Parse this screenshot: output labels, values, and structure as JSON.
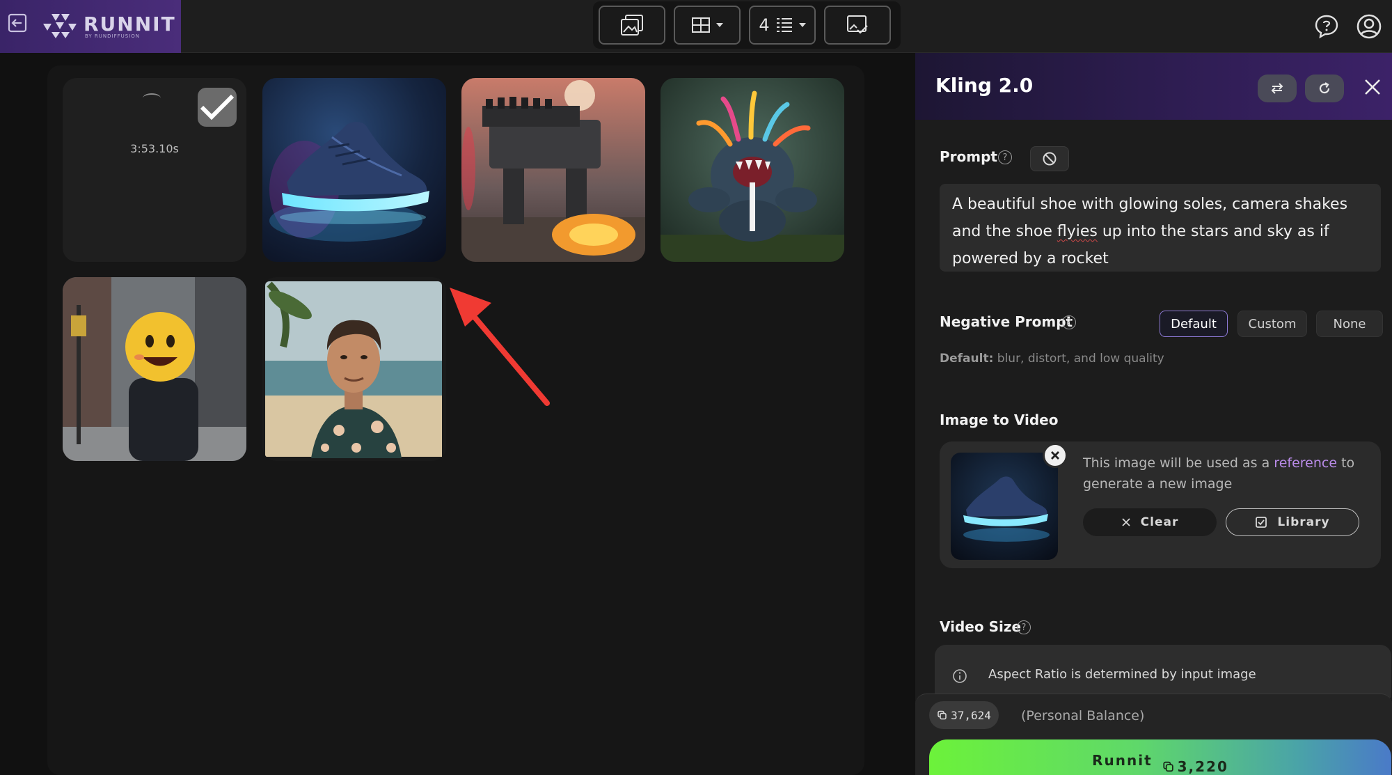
{
  "brand": {
    "name": "RUNNIT",
    "sub": "BY RUNDIFFUSION"
  },
  "toolbar": {
    "count_value": "4"
  },
  "gallery": {
    "pending_timer": "3:53.10s"
  },
  "panel": {
    "title": "Kling 2.0",
    "prompt_label": "Prompt",
    "prompt_help": "?",
    "prompt_before": "A beautiful shoe with glowing soles, camera shakes and the shoe ",
    "prompt_misspelled": "flyies",
    "prompt_after": " up into the stars and sky as if powered by a rocket",
    "negative_label": "Negative Prompt",
    "negative_options": [
      "Default",
      "Custom",
      "None"
    ],
    "negative_selected": "Default",
    "negative_default_prefix": "Default:",
    "negative_default_text": " blur, distort, and low quality",
    "image_to_video_label": "Image to Video",
    "itv_text_before": "This image will be used as a ",
    "itv_text_link": "reference",
    "itv_text_after": " to generate a new image",
    "clear_label": "Clear",
    "library_label": "Library",
    "video_size_label": "Video Size",
    "aspect_text": "Aspect Ratio is determined by input image",
    "balance_value": "37,624",
    "balance_label": "(Personal Balance)",
    "runnit_label": "Runnit",
    "runnit_cost": "3,220"
  },
  "colors": {
    "accent_purple": "#8d79d6",
    "link_purple": "#b98be8",
    "arrow_red": "#f03a33",
    "run_green": "#6cf23a"
  }
}
